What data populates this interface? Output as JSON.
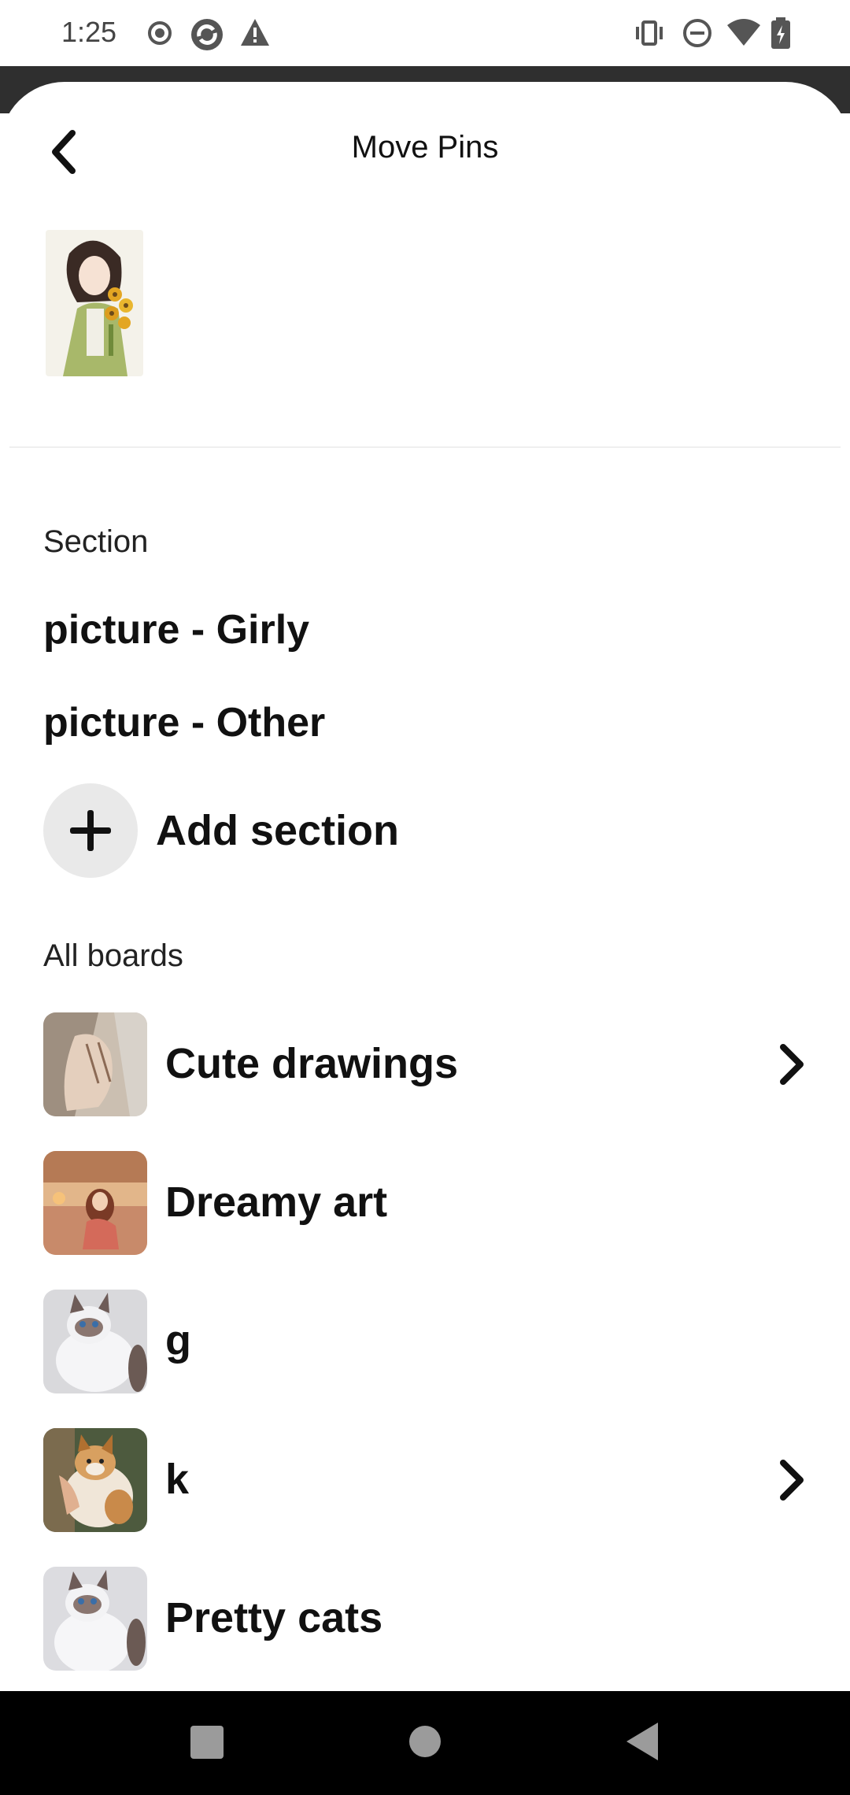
{
  "status_bar": {
    "time": "1:25",
    "left_icons": [
      "record-icon",
      "sync-icon",
      "warning-icon"
    ],
    "right_icons": [
      "vibrate-icon",
      "do-not-disturb-icon",
      "wifi-icon",
      "battery-charging-icon"
    ]
  },
  "header": {
    "title": "Move Pins",
    "back_icon": "chevron-left-icon"
  },
  "sections": {
    "label": "Section",
    "items": [
      "picture - Girly",
      "picture - Other"
    ],
    "add_label": "Add section"
  },
  "boards": {
    "label": "All boards",
    "items": [
      {
        "name": "Cute drawings",
        "has_sections": true
      },
      {
        "name": "Dreamy art",
        "has_sections": false
      },
      {
        "name": "g",
        "has_sections": false
      },
      {
        "name": "k",
        "has_sections": true
      },
      {
        "name": "Pretty cats",
        "has_sections": false
      }
    ]
  },
  "navigation": [
    "recents-square-icon",
    "home-circle-icon",
    "back-triangle-icon"
  ]
}
